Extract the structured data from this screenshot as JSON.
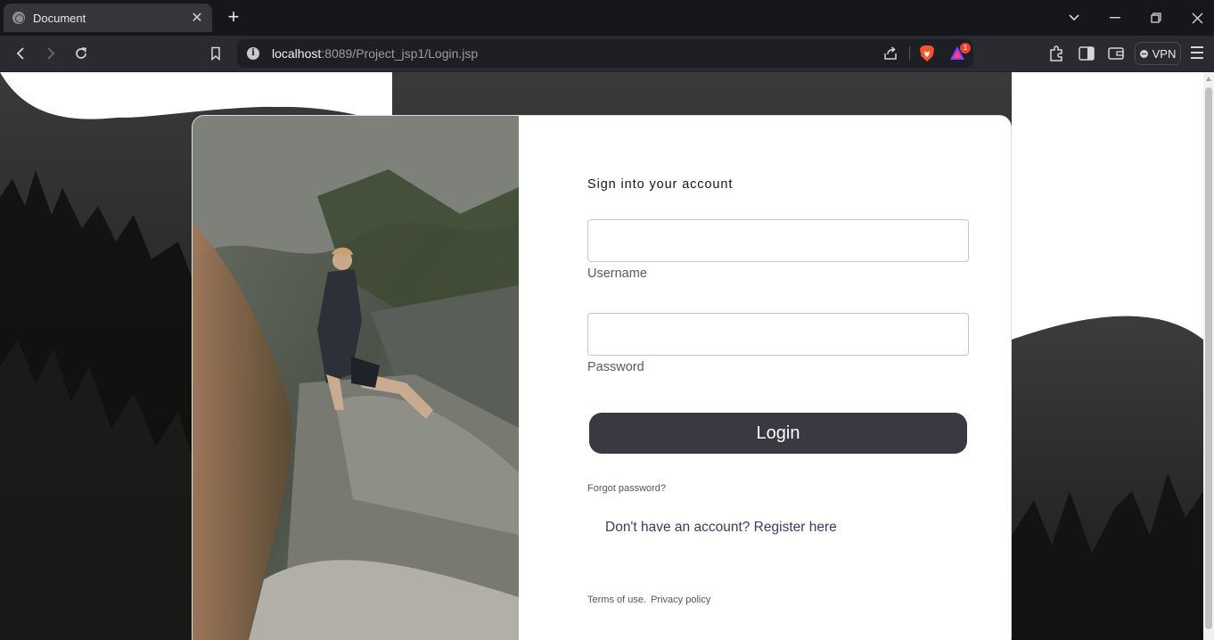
{
  "browser": {
    "tab_title": "Document",
    "tab_close": "✕",
    "new_tab": "+",
    "url_host": "localhost",
    "url_rest": ":8089/Project_jsp1/Login.jsp",
    "rewards_badge": "1",
    "vpn_label": "VPN",
    "window_controls": {
      "dropdown": "⌄",
      "minimize": "—",
      "restore": "❐",
      "close": "✕"
    },
    "nav": {
      "back": "‹",
      "forward": "›",
      "reload": "↻"
    }
  },
  "login": {
    "heading": "Sign into your account",
    "username_label": "Username",
    "username_value": "",
    "password_label": "Password",
    "password_value": "",
    "login_button": "Login",
    "forgot_password": "Forgot password?",
    "register_link": "Don't have an account? Register here",
    "terms": "Terms of use.",
    "privacy": "Privacy policy"
  },
  "colors": {
    "button_bg": "#393a41",
    "register_link": "#393b66",
    "chrome_bg": "#16171c"
  }
}
